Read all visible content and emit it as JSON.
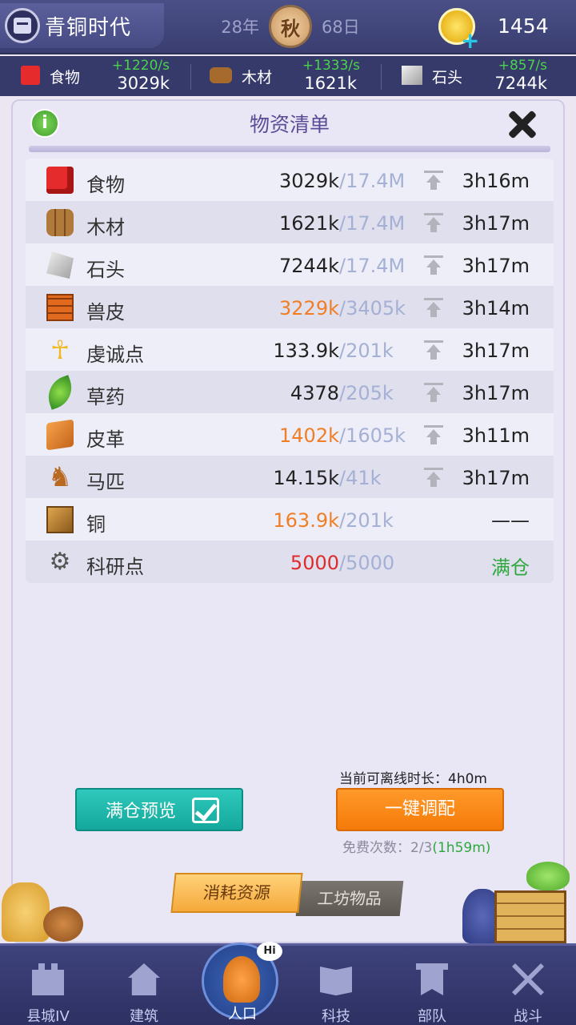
{
  "header": {
    "era_title": "青铜时代",
    "year": "28年",
    "season": "秋",
    "day": "68日",
    "gold": "1454"
  },
  "resource_bar": [
    {
      "name": "食物",
      "rate": "+1220/s",
      "value": "3029k",
      "icon": "food-icon"
    },
    {
      "name": "木材",
      "rate": "+1333/s",
      "value": "1621k",
      "icon": "wood-icon"
    },
    {
      "name": "石头",
      "rate": "+857/s",
      "value": "7244k",
      "icon": "stone-icon"
    }
  ],
  "panel": {
    "title": "物资清单",
    "info_label": "i",
    "rows": [
      {
        "name": "食物",
        "amount": "3029k",
        "cap": "/17.4M",
        "time": "3h16m",
        "icon": "food-icon",
        "amount_color": "normal"
      },
      {
        "name": "木材",
        "amount": "1621k",
        "cap": "/17.4M",
        "time": "3h17m",
        "icon": "wood-icon",
        "amount_color": "normal"
      },
      {
        "name": "石头",
        "amount": "7244k",
        "cap": "/17.4M",
        "time": "3h17m",
        "icon": "stone-icon",
        "amount_color": "normal"
      },
      {
        "name": "兽皮",
        "amount": "3229k",
        "cap": "/3405k",
        "time": "3h14m",
        "icon": "hide-icon",
        "amount_color": "orange"
      },
      {
        "name": "虔诚点",
        "amount": "133.9k",
        "cap": "/201k",
        "time": "3h17m",
        "icon": "ankh-icon",
        "amount_color": "normal"
      },
      {
        "name": "草药",
        "amount": "4378",
        "cap": "/205k",
        "time": "3h17m",
        "icon": "herb-icon",
        "amount_color": "normal"
      },
      {
        "name": "皮革",
        "amount": "1402k",
        "cap": "/1605k",
        "time": "3h11m",
        "icon": "leather-icon",
        "amount_color": "orange"
      },
      {
        "name": "马匹",
        "amount": "14.15k",
        "cap": "/41k",
        "time": "3h17m",
        "icon": "horse-icon",
        "amount_color": "normal"
      },
      {
        "name": "铜",
        "amount": "163.9k",
        "cap": "/201k",
        "time": "——",
        "icon": "copper-icon",
        "amount_color": "orange"
      },
      {
        "name": "科研点",
        "amount": "5000",
        "cap": "/5000",
        "time": "满仓",
        "icon": "gear-icon",
        "amount_color": "red"
      }
    ],
    "offline_label": "当前可离线时长：4h0m",
    "preview_button": "满仓预览",
    "dispatch_button": "一键调配",
    "free_label": "免费次数：2/3",
    "free_timer": "(1h59m)",
    "tab_consume": "消耗资源",
    "tab_workshop": "工坊物品"
  },
  "nav": [
    {
      "label": "县城IV",
      "icon": "castle-icon"
    },
    {
      "label": "建筑",
      "icon": "house-icon"
    },
    {
      "label": "人口",
      "icon": "person-icon",
      "badge": "Hi"
    },
    {
      "label": "科技",
      "icon": "book-icon"
    },
    {
      "label": "部队",
      "icon": "banner-icon"
    },
    {
      "label": "战斗",
      "icon": "swords-icon"
    }
  ],
  "colors": {
    "header_bg": "#3a3e70",
    "panel_bg": "#e9e7f6",
    "title": "#5c4c97",
    "rate_green": "#4bd24b",
    "orange": "#f07e25",
    "red": "#e02b2b",
    "cap_blue": "#a4b0d4",
    "teal_button": "#14a89c",
    "orange_button": "#f57a08"
  }
}
